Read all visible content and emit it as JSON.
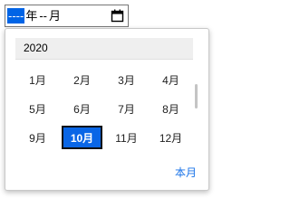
{
  "input": {
    "year_placeholder": "----",
    "year_suffix": "年",
    "month_placeholder": "--",
    "month_suffix": "月",
    "calendar_icon": "calendar-icon"
  },
  "picker": {
    "year_label": "2020",
    "months": [
      "1月",
      "2月",
      "3月",
      "4月",
      "5月",
      "6月",
      "7月",
      "8月",
      "9月",
      "10月",
      "11月",
      "12月"
    ],
    "selected_index": 9,
    "this_month_label": "本月"
  },
  "colors": {
    "selection": "#0a66e6",
    "link": "#1a73e8"
  }
}
